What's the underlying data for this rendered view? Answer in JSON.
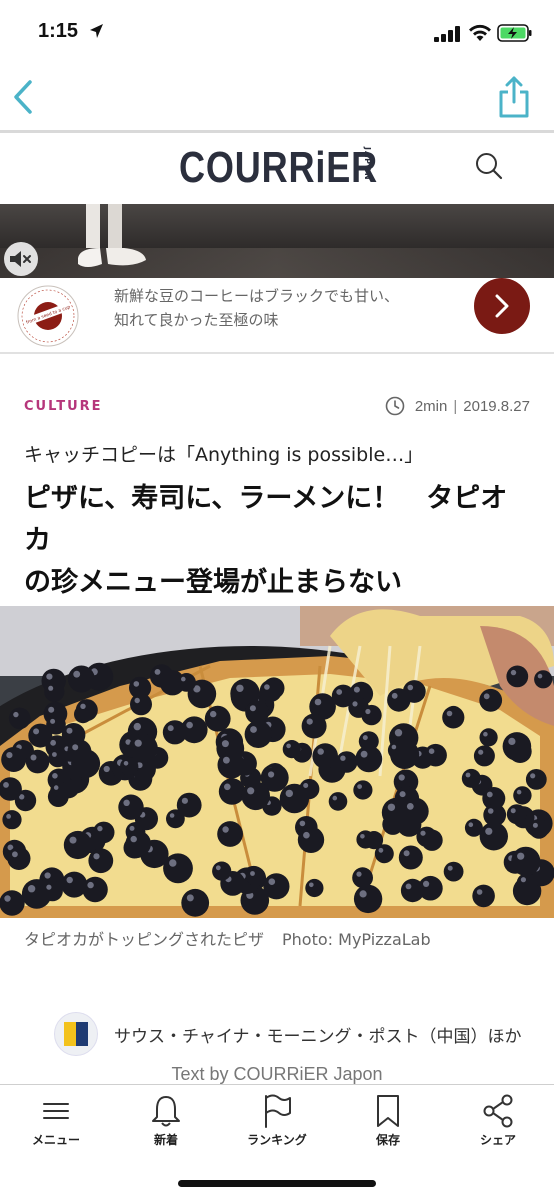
{
  "status_bar": {
    "time": "1:15"
  },
  "header": {
    "logo": "COURRiER",
    "logo_sub": "JAPON"
  },
  "ad": {
    "text_line1": "新鮮な豆のコーヒーはブラックでも甘い、",
    "text_line2": "知れて良かった至極の味",
    "logo_ring_text": "from a seed to a cup"
  },
  "article": {
    "category": "CULTURE",
    "read_time": "2min",
    "date": "2019.8.27",
    "subtitle": "キャッチコピーは「Anything is possible…」",
    "title_line1": "ピザに、寿司に、ラーメンに！　タピオカ",
    "title_line2": "の珍メニュー登場が止まらない",
    "caption": "タピオカがトッピングされたピザ",
    "photo_credit": "Photo: MyPizzaLab",
    "source": "サウス・チャイナ・モーニング・ポスト（中国）ほか",
    "text_by": "Text by COURRiER Japon"
  },
  "tabbar": {
    "items": [
      {
        "label": "メニュー",
        "icon": "menu-icon"
      },
      {
        "label": "新着",
        "icon": "bell-icon"
      },
      {
        "label": "ランキング",
        "icon": "flag-icon"
      },
      {
        "label": "保存",
        "icon": "bookmark-icon"
      },
      {
        "label": "シェア",
        "icon": "share-nodes-icon"
      }
    ]
  },
  "colors": {
    "accent": "#4bb3c8",
    "category": "#b6367b",
    "logo": "#2b2f3d",
    "ad_button": "#7a1a14"
  }
}
